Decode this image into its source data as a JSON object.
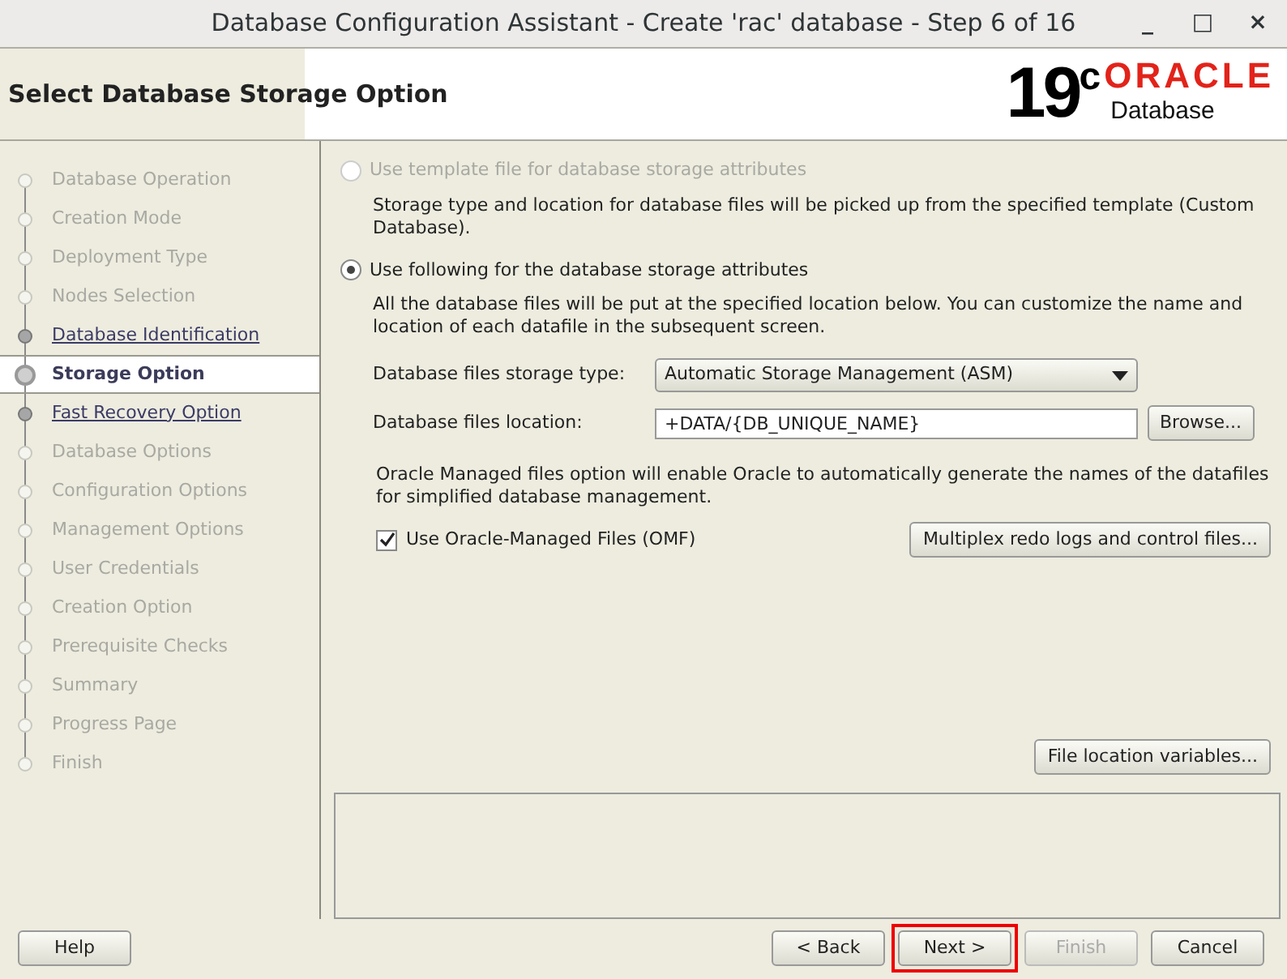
{
  "window": {
    "title": "Database Configuration Assistant - Create 'rac' database - Step 6 of 16",
    "controls": [
      "_",
      "□",
      "×"
    ]
  },
  "header": {
    "title": "Select Database Storage Option",
    "logo": {
      "version": "19",
      "sup": "c",
      "brand": "ORACLE",
      "product": "Database"
    }
  },
  "steps": [
    {
      "label": "Database Operation",
      "kind": "pending"
    },
    {
      "label": "Creation Mode",
      "kind": "pending"
    },
    {
      "label": "Deployment Type",
      "kind": "pending"
    },
    {
      "label": "Nodes Selection",
      "kind": "pending"
    },
    {
      "label": "Database Identification",
      "kind": "link"
    },
    {
      "label": "Storage Option",
      "kind": "current"
    },
    {
      "label": "Fast Recovery Option",
      "kind": "link"
    },
    {
      "label": "Database Options",
      "kind": "pending"
    },
    {
      "label": "Configuration Options",
      "kind": "pending"
    },
    {
      "label": "Management Options",
      "kind": "pending"
    },
    {
      "label": "User Credentials",
      "kind": "pending"
    },
    {
      "label": "Creation Option",
      "kind": "pending"
    },
    {
      "label": "Prerequisite Checks",
      "kind": "pending"
    },
    {
      "label": "Summary",
      "kind": "pending"
    },
    {
      "label": "Progress Page",
      "kind": "pending"
    },
    {
      "label": "Finish",
      "kind": "pending"
    }
  ],
  "options": [
    {
      "label": "Use template file for database storage attributes",
      "selected": false,
      "disabled": true,
      "description": "Storage type and location for database files will be picked up from the specified template (Custom Database)."
    },
    {
      "label": "Use following for the database storage attributes",
      "selected": true,
      "disabled": false,
      "description": "All the database files will be put at the specified location below. You can customize the name and location of each datafile in the subsequent screen."
    }
  ],
  "storage_type": {
    "label": "Database files storage type:",
    "value": "Automatic Storage Management (ASM)"
  },
  "location": {
    "label": "Database files location:",
    "value": "+DATA/{DB_UNIQUE_NAME}",
    "button": "Browse..."
  },
  "omf": {
    "note": "Oracle Managed files option will enable Oracle to automatically generate the names of the datafiles for simplified database management.",
    "label": "Use Oracle-Managed Files (OMF)",
    "checked": true,
    "button": "Multiplex redo logs and control files..."
  },
  "file_location_button": "File location variables...",
  "buttons": [
    {
      "label": "Help",
      "disabled": false,
      "highlighted": false
    },
    {
      "label": "< Back",
      "disabled": false,
      "highlighted": false
    },
    {
      "label": "Next >",
      "disabled": false,
      "highlighted": true
    },
    {
      "label": "Finish",
      "disabled": true,
      "highlighted": false
    },
    {
      "label": "Cancel",
      "disabled": false,
      "highlighted": false
    }
  ]
}
